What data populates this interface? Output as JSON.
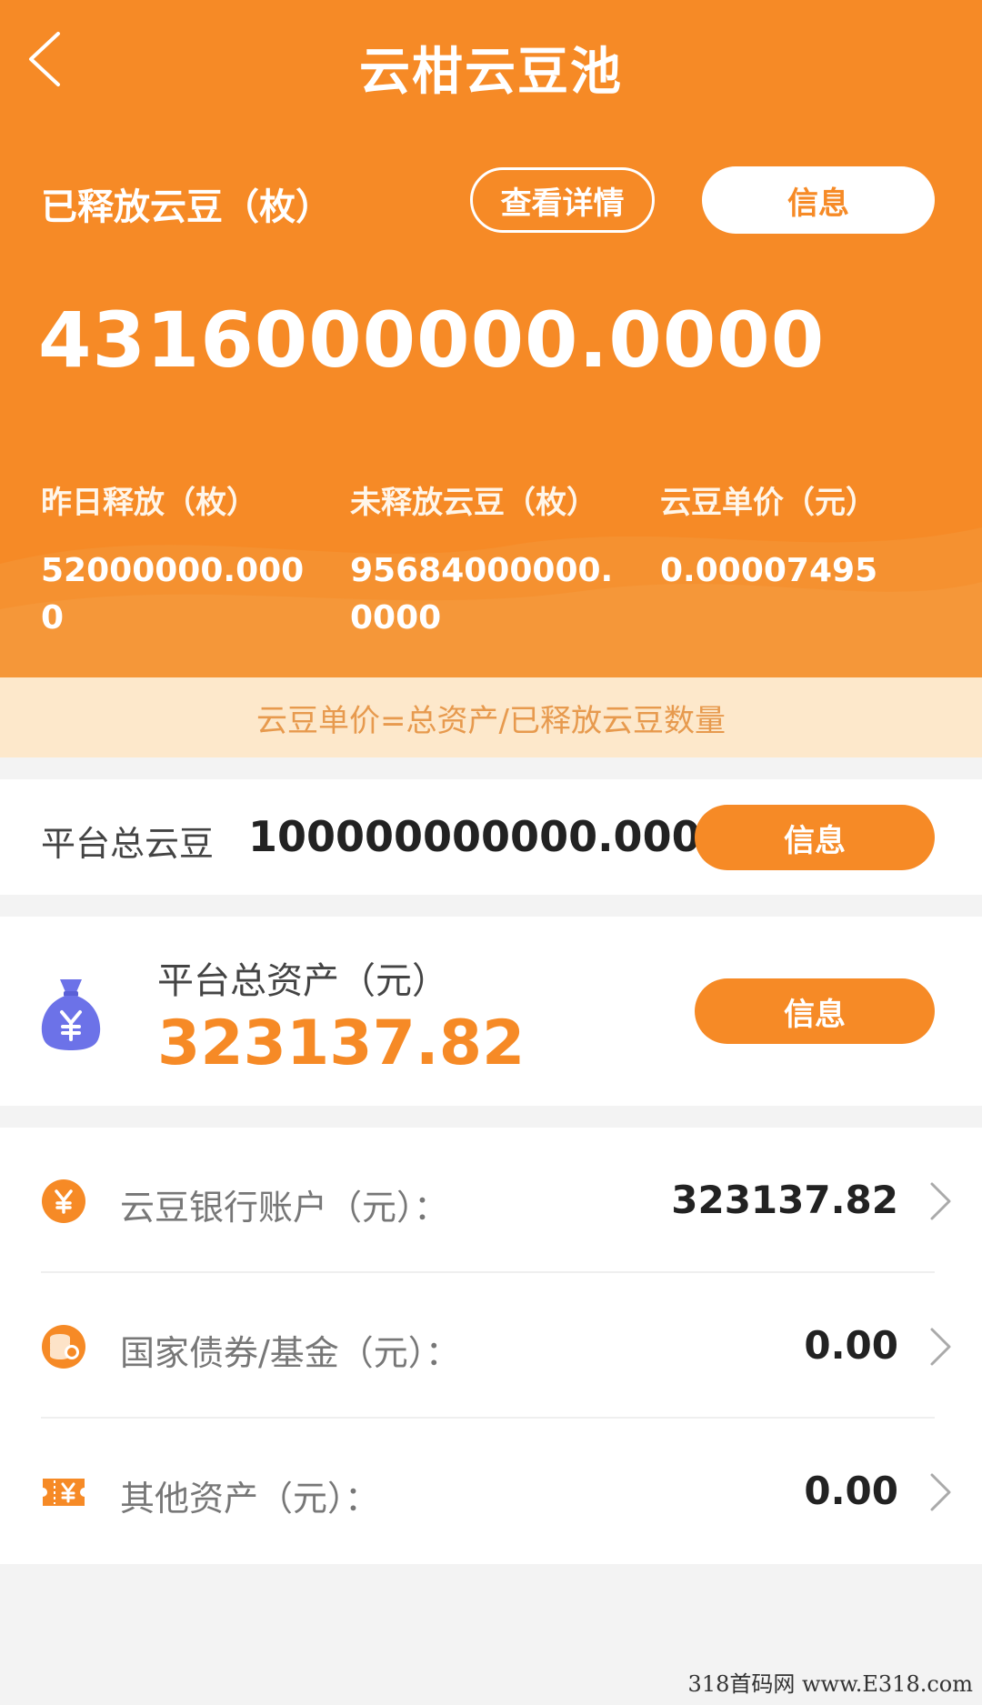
{
  "header": {
    "title": "云柑云豆池"
  },
  "released": {
    "label": "已释放云豆（枚）",
    "detail_button": "查看详情",
    "info_button": "信息",
    "value": "4316000000.0000"
  },
  "stats": [
    {
      "label": "昨日释放（枚）",
      "value": "52000000.0000"
    },
    {
      "label": "未释放云豆（枚）",
      "value": "95684000000.0000"
    },
    {
      "label": "云豆单价（元）",
      "value": "0.00007495"
    }
  ],
  "formula": "云豆单价=总资产/已释放云豆数量",
  "platform_total": {
    "label": "平台总云豆",
    "value": "100000000000.0000",
    "info_button": "信息"
  },
  "platform_assets": {
    "label": "平台总资产（元）",
    "value": "323137.82",
    "info_button": "信息",
    "icon": "money-bag-icon"
  },
  "asset_list": [
    {
      "label": "云豆银行账户（元）：",
      "value": "323137.82",
      "icon": "yuan-coin-icon"
    },
    {
      "label": "国家债券/基金（元）：",
      "value": "0.00",
      "icon": "coin-stack-icon"
    },
    {
      "label": "其他资产（元）：",
      "value": "0.00",
      "icon": "yuan-ticket-icon"
    }
  ],
  "watermark": "318首码网 www.E318.com",
  "colors": {
    "brand_orange": "#f68a26",
    "banner_bg": "#fde8cb",
    "banner_text": "#e79a4e",
    "moneybag_purple": "#6c72e8"
  }
}
